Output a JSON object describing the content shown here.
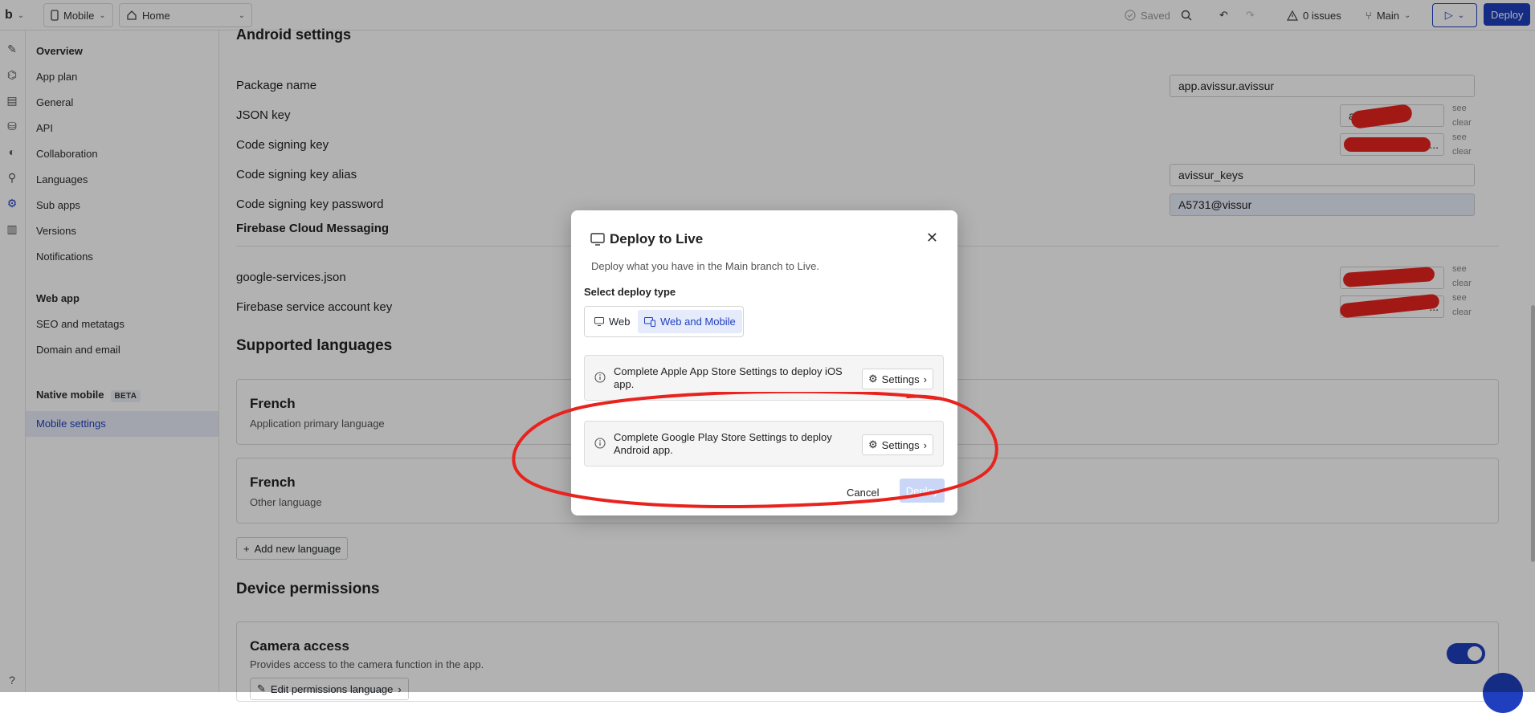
{
  "topbar": {
    "logo": "b",
    "device": "Mobile",
    "page": "Home",
    "saved": "Saved",
    "issues": "0 issues",
    "branch": "Main",
    "deploy": "Deploy"
  },
  "sidebar": {
    "items": [
      "Overview",
      "App plan",
      "General",
      "API",
      "Collaboration",
      "Languages",
      "Sub apps",
      "Versions",
      "Notifications"
    ],
    "web_app_heading": "Web app",
    "web_items": [
      "SEO and metatags",
      "Domain and email"
    ],
    "native_heading": "Native mobile",
    "beta": "BETA",
    "active": "Mobile settings"
  },
  "main": {
    "android_title": "Android settings",
    "package_label": "Package name",
    "package_value": "app.avissur.avissur",
    "json_key_label": "JSON key",
    "json_key_value": "a...ode4...",
    "code_signing_label": "Code signing key",
    "code_signing_value": "...",
    "alias_label": "Code signing key alias",
    "alias_value": "avissur_keys",
    "password_label": "Code signing key password",
    "password_value": "A5731@vissur",
    "firebase_title": "Firebase Cloud Messaging",
    "gservices_label": "google-services.json",
    "gservices_value": "...services....",
    "sak_label": "Firebase service account key",
    "sak_value": "...",
    "see": "see",
    "clear": "clear",
    "languages_title": "Supported languages",
    "lang1_title": "French",
    "lang1_sub": "Application primary language",
    "lang2_title": "French",
    "lang2_sub": "Other language",
    "add_language": "Add new language",
    "permissions_title": "Device permissions",
    "camera_title": "Camera access",
    "camera_sub": "Provides access to the camera function in the app.",
    "edit_permissions": "Edit permissions language"
  },
  "modal": {
    "title": "Deploy to Live",
    "description": "Deploy what you have in the Main branch to Live.",
    "select_label": "Select deploy type",
    "option_web": "Web",
    "option_web_mobile": "Web and Mobile",
    "ios_notice": "Complete Apple App Store Settings to deploy iOS app.",
    "android_notice": "Complete Google Play Store Settings to deploy Android app.",
    "settings": "Settings",
    "cancel": "Cancel",
    "deploy": "Deploy"
  },
  "colors": {
    "accent": "#1f3fbf",
    "annotation_red": "#e8231e"
  }
}
